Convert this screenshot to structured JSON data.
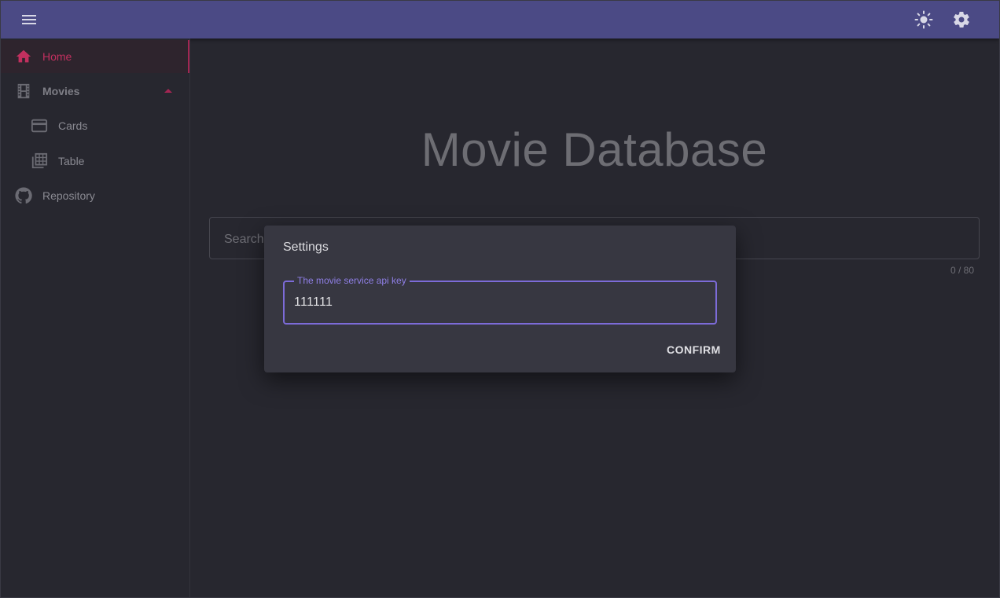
{
  "appbar": {
    "menu_icon": "menu-icon",
    "theme_icon": "sun-icon",
    "settings_icon": "gear-icon",
    "color": "#4b4a85"
  },
  "sidebar": {
    "items": [
      {
        "label": "Home",
        "icon": "home-icon",
        "active": true
      },
      {
        "label": "Movies",
        "icon": "film-icon",
        "expanded": true
      },
      {
        "label": "Cards",
        "icon": "card-icon"
      },
      {
        "label": "Table",
        "icon": "table-icon"
      },
      {
        "label": "Repository",
        "icon": "github-icon"
      }
    ],
    "accent": "#a32653"
  },
  "main": {
    "title": "Movie Database",
    "search": {
      "placeholder": "Search",
      "counter": "0 / 80"
    }
  },
  "dialog": {
    "title": "Settings",
    "field_label": "The movie service api key",
    "field_value": "111111",
    "confirm_label": "CONFIRM",
    "accent": "#7c6bd8"
  }
}
